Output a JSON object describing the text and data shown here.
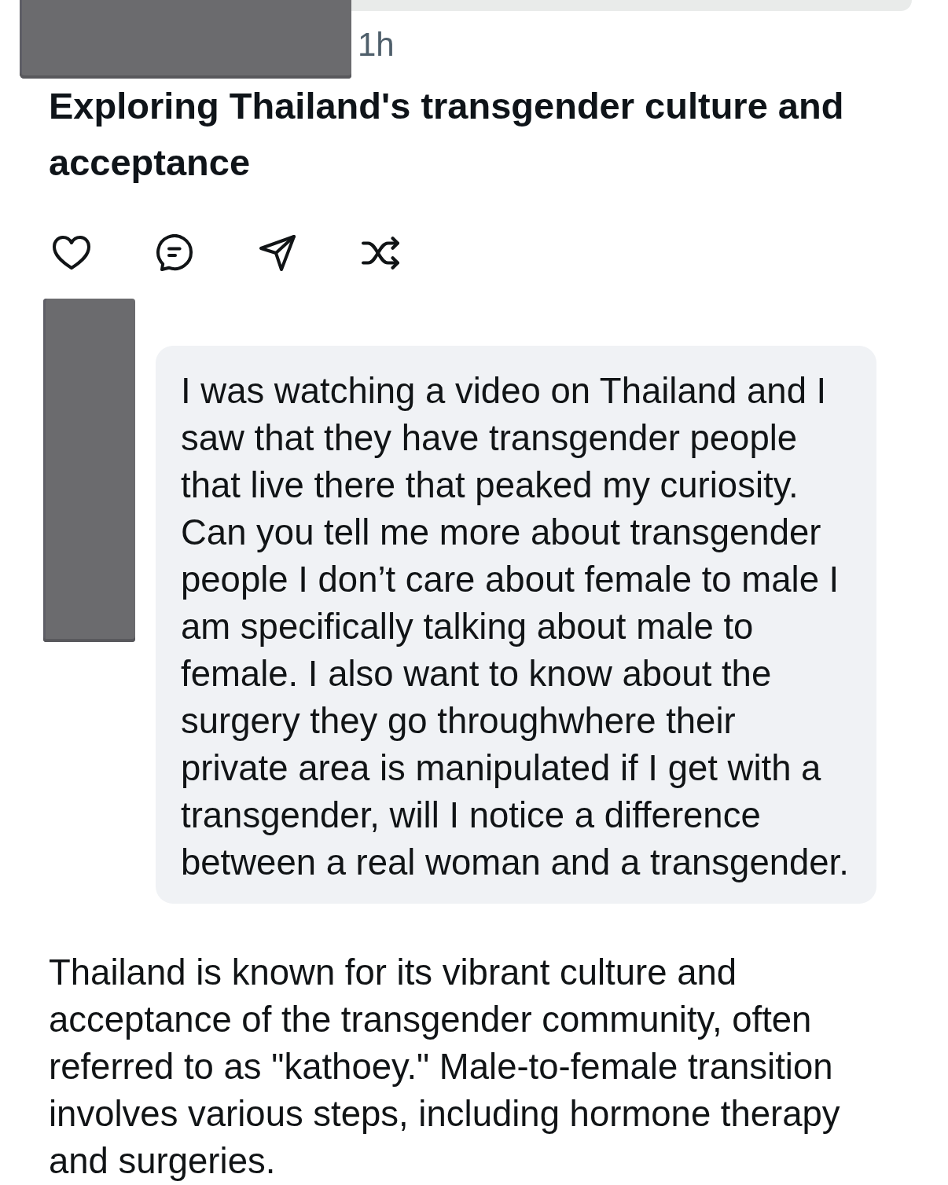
{
  "post": {
    "time": "1h",
    "title": "Exploring Thailand's transgender culture and acceptance"
  },
  "prompt": {
    "text": "I was watching a video on Thailand and I saw that they have transgender people that live there that peaked my curiosity. Can you tell me more about transgender people I don’t care about female to male I am specifically talking about male to female. I also want to know about the surgery they go throughwhere their private area is manipulated if I get with a transgender, will I notice a difference between a real woman and a transgender."
  },
  "response": {
    "text": "Thailand is known for its vibrant culture and acceptance of the transgender community, often referred to as \"kathoey.\" Male-to-female transition involves various steps, including hormone therapy and surgeries."
  }
}
